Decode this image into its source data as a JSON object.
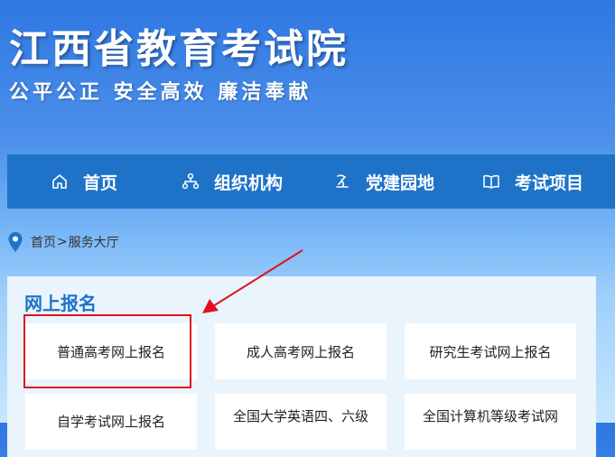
{
  "header": {
    "title": "江西省教育考试院",
    "slogan": "公平公正  安全高效  廉洁奉献"
  },
  "nav": {
    "items": [
      {
        "label": "首页",
        "icon": "home-icon"
      },
      {
        "label": "组织机构",
        "icon": "org-chart-icon"
      },
      {
        "label": "党建园地",
        "icon": "party-building-icon"
      },
      {
        "label": "考试项目",
        "icon": "book-icon"
      }
    ]
  },
  "breadcrumb": {
    "icon": "location-pin-icon",
    "home": "首页",
    "separator": ">",
    "current": "服务大厅"
  },
  "section": {
    "title": "网上报名",
    "cards": [
      {
        "label": "普通高考网上报名"
      },
      {
        "label": "成人高考网上报名"
      },
      {
        "label": "研究生考试网上报名"
      },
      {
        "label": "自学考试网上报名"
      },
      {
        "label": "全国大学英语四、六级"
      },
      {
        "label": "全国计算机等级考试网"
      }
    ]
  },
  "annotation": {
    "highlight_color": "#e0121b",
    "arrow_color": "#e0121b"
  },
  "colors": {
    "nav_background": "#1e73c8",
    "section_title": "#1e73c8",
    "panel_background": "#eaf4fd"
  }
}
